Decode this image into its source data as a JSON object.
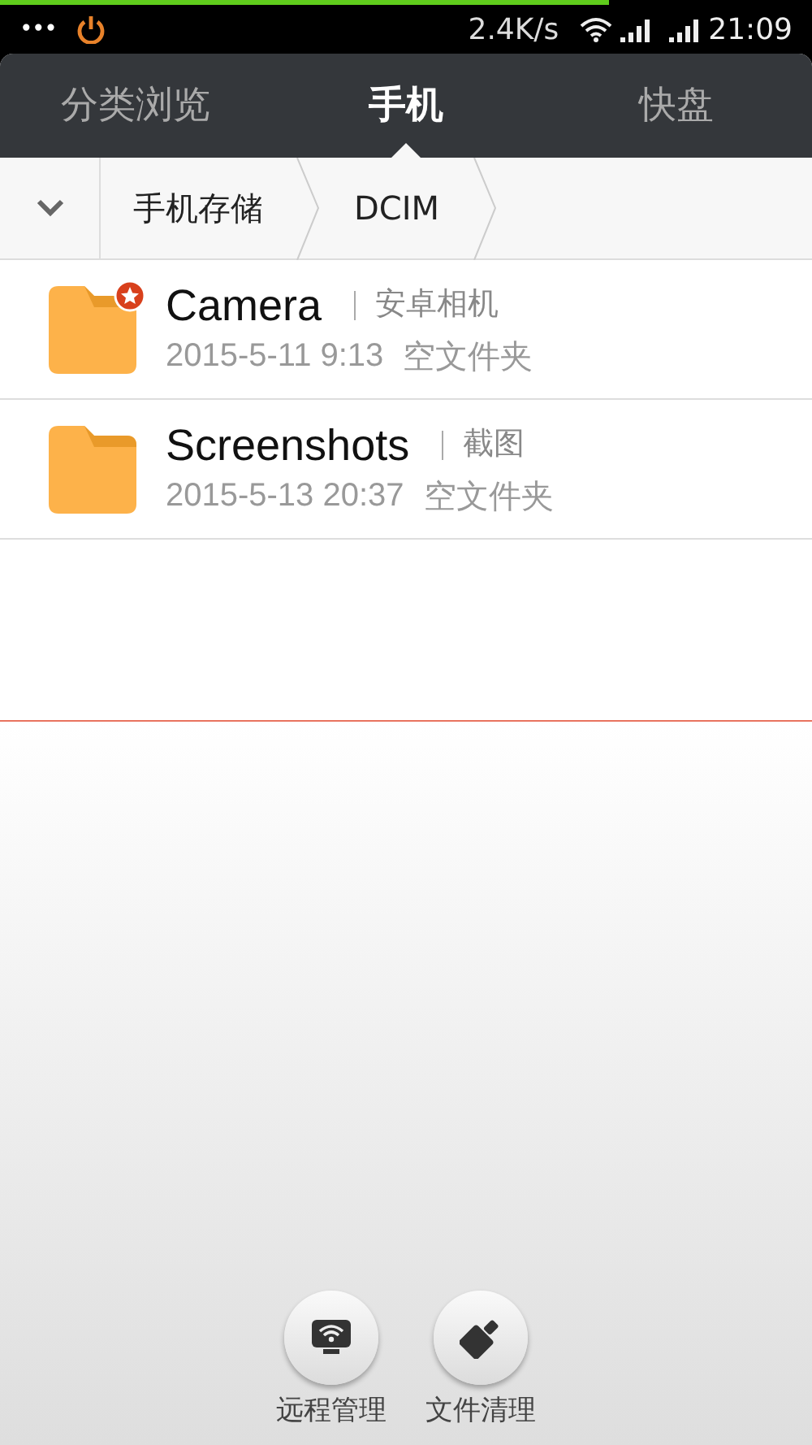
{
  "progress": {
    "level": 0.75
  },
  "status_bar": {
    "menu": "•••",
    "speed": "2.4K/s",
    "time": "21:09"
  },
  "tabs": [
    {
      "label": "分类浏览",
      "selected": false
    },
    {
      "label": "手机",
      "selected": true
    },
    {
      "label": "快盘",
      "selected": false
    }
  ],
  "breadcrumb": [
    "手机存储",
    "DCIM"
  ],
  "folders": [
    {
      "name": "Camera",
      "alias": "安卓相机",
      "date": "2015-5-11 9:13",
      "info": "空文件夹",
      "starred": true
    },
    {
      "name": "Screenshots",
      "alias": "截图",
      "date": "2015-5-13 20:37",
      "info": "空文件夹",
      "starred": false
    }
  ],
  "actions": [
    {
      "kind": "remote",
      "label": "远程管理"
    },
    {
      "kind": "clean",
      "label": "文件清理"
    }
  ]
}
